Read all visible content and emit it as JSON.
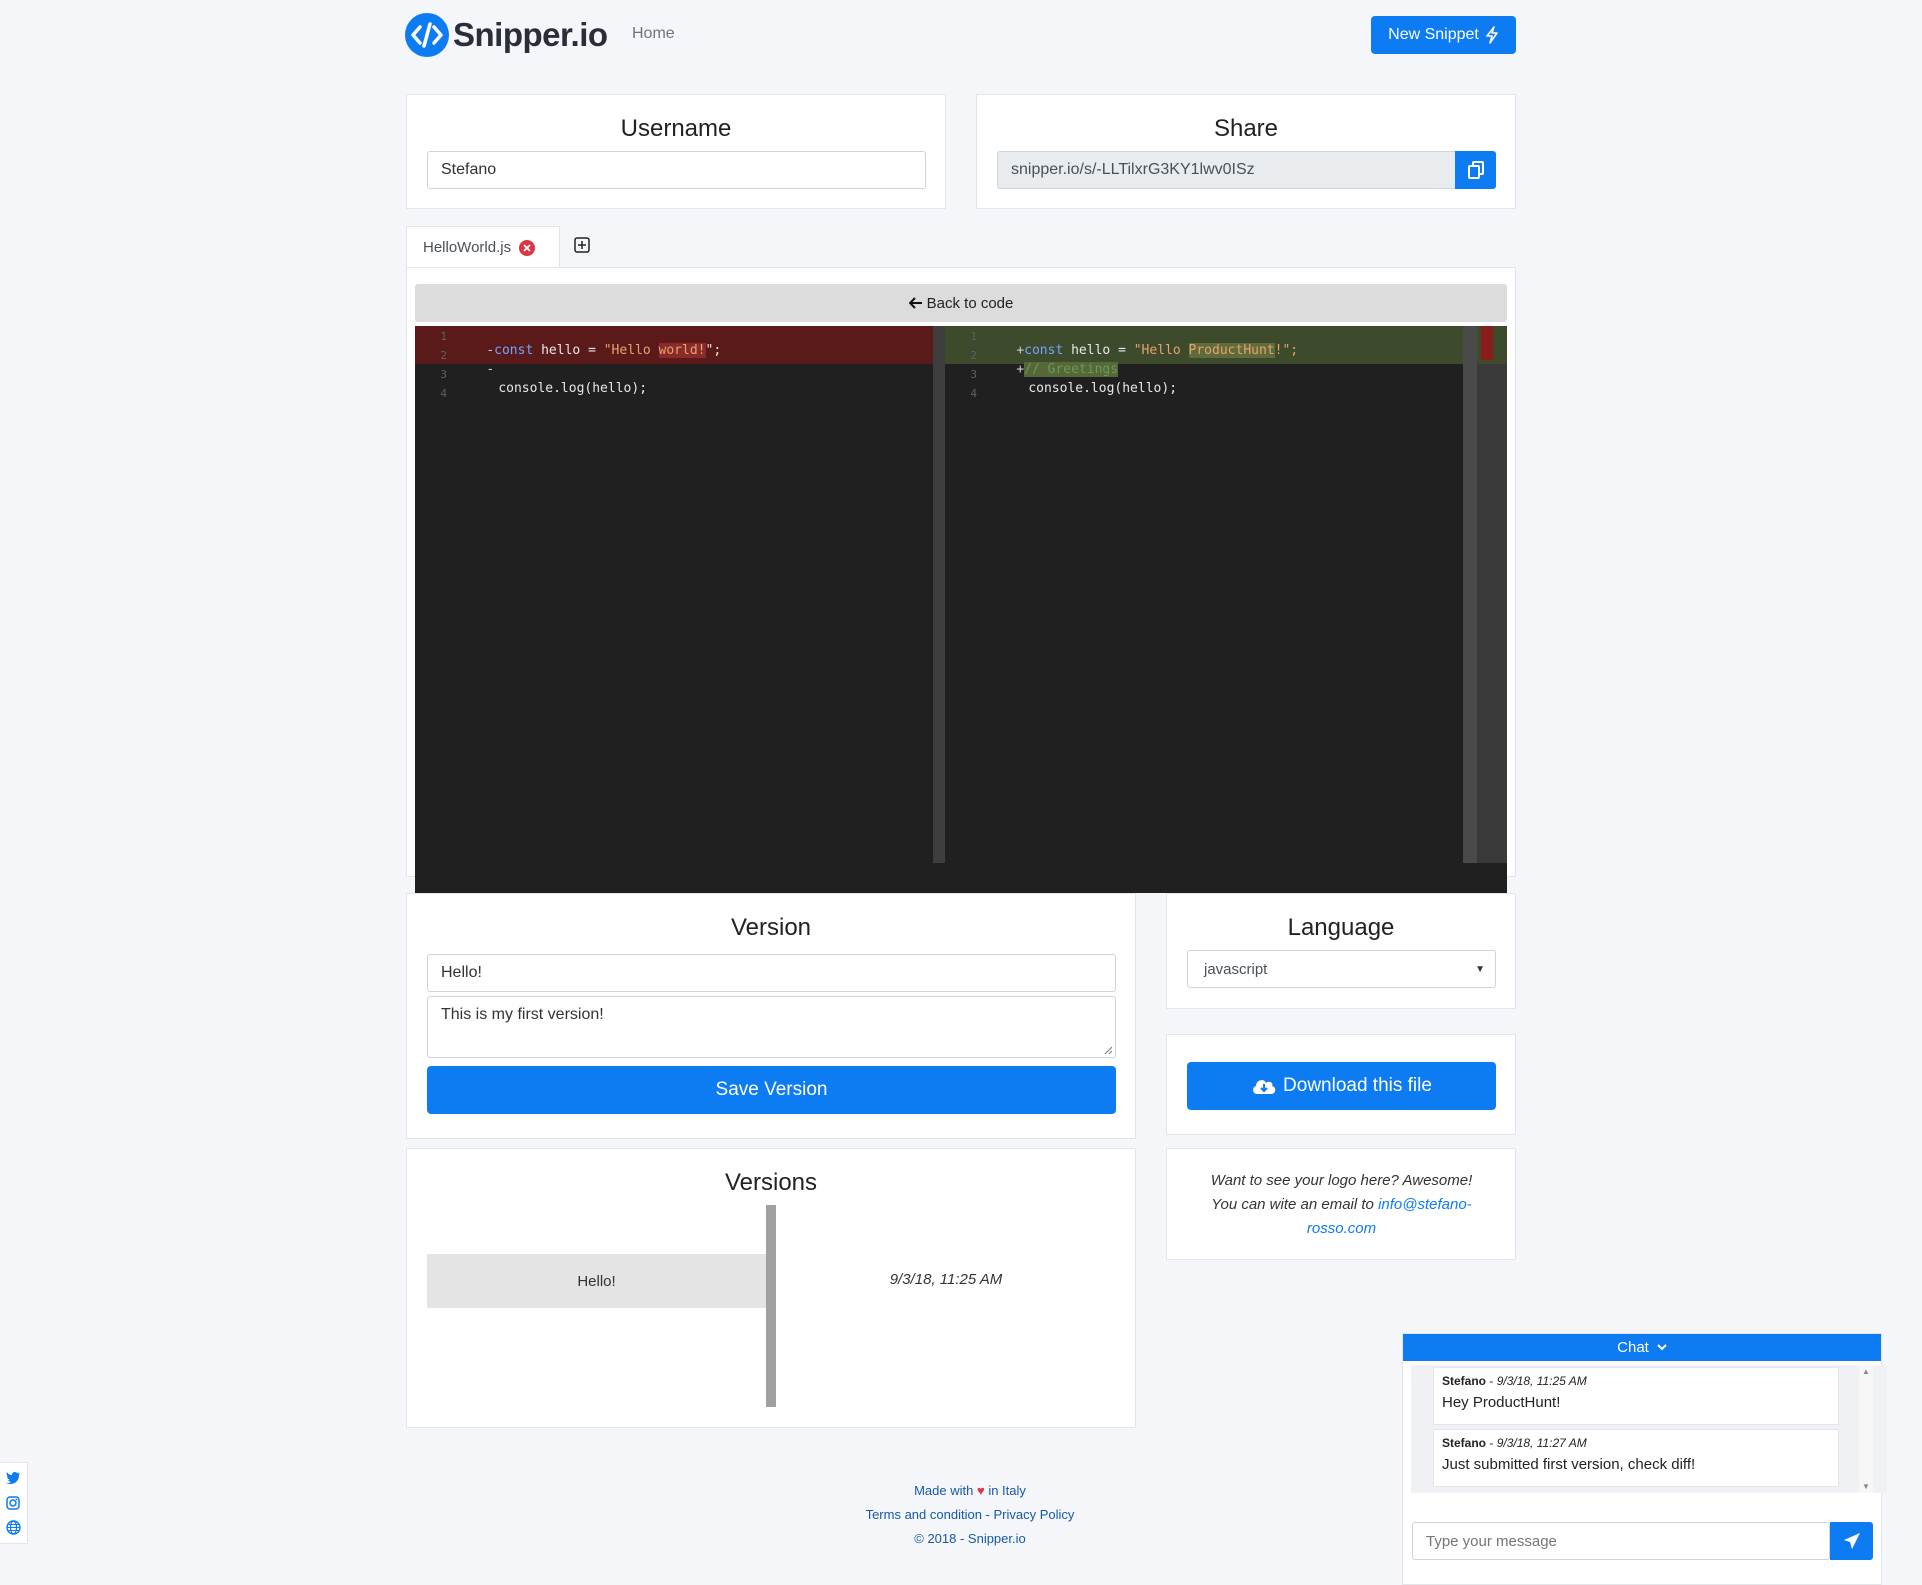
{
  "header": {
    "brand": "Snipper.io",
    "nav_home": "Home",
    "new_snippet": "New Snippet"
  },
  "username": {
    "title": "Username",
    "value": "Stefano"
  },
  "share": {
    "title": "Share",
    "url": "snipper.io/s/-LLTilxrG3KY1lwv0ISz"
  },
  "tabs": {
    "file_name": "HelloWorld.js"
  },
  "diff": {
    "back_label": "Back to code",
    "left": {
      "line_numbers": [
        "1",
        "2",
        "3",
        "4"
      ],
      "line1_marker": "-",
      "line1_kw": "const",
      "line1_rest": " hello = ",
      "line1_str_open": "\"Hello ",
      "line1_str_changed": "world!",
      "line1_str_close": "\";",
      "line2_marker": "-",
      "line3": "console.log(hello);"
    },
    "right": {
      "line_numbers": [
        "1",
        "2",
        "3",
        "4"
      ],
      "line1_marker": "+",
      "line1_kw": "const",
      "line1_rest": " hello = ",
      "line1_str_open": "\"Hello ",
      "line1_str_changed": "ProductHunt",
      "line1_str_close": "!\";",
      "line2_marker": "+",
      "line2_comment": "// Greetings",
      "line3": "console.log(hello);"
    }
  },
  "version": {
    "title": "Version",
    "name_value": "Hello!",
    "description_value": "This is my first version!",
    "save_label": "Save Version"
  },
  "language": {
    "title": "Language",
    "selected": "javascript"
  },
  "download": {
    "label": "Download this file"
  },
  "ad": {
    "line1": "Want to see your logo here? Awesome!",
    "line2_prefix": "You can wite an email to ",
    "email_part1": "info@stefano-",
    "email_part2": "rosso.com"
  },
  "versions": {
    "title": "Versions",
    "items": [
      {
        "name": "Hello!",
        "date": "9/3/18, 11:25 AM"
      }
    ]
  },
  "footer": {
    "made_with_prefix": "Made with",
    "made_with_suffix": "in Italy",
    "terms": "Terms and condition",
    "separator": " - ",
    "privacy": "Privacy Policy",
    "copyright": "© 2018 - Snipper.io"
  },
  "chat": {
    "title": "Chat",
    "messages": [
      {
        "author": "Stefano",
        "sep": " - ",
        "time": "9/3/18, 11:25 AM",
        "text": "Hey ProductHunt!"
      },
      {
        "author": "Stefano",
        "sep": " - ",
        "time": "9/3/18, 11:27 AM",
        "text": "Just submitted first version, check diff!"
      }
    ],
    "input_placeholder": "Type your message"
  },
  "colors": {
    "accent": "#0d7cf2",
    "diff_removed": "#5b1a1a",
    "diff_added": "#3d4a2c",
    "footer_link": "#1459a8"
  }
}
